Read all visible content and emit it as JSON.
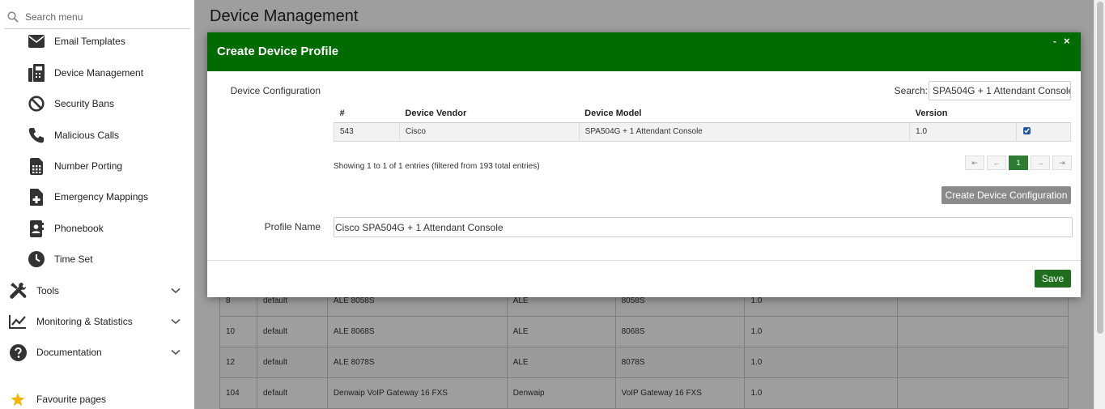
{
  "sidebar": {
    "search_placeholder": "Search menu",
    "items": [
      {
        "label": "Email Templates",
        "icon": "envelope-icon"
      },
      {
        "label": "Device Management",
        "icon": "fax-icon"
      },
      {
        "label": "Security Bans",
        "icon": "ban-icon"
      },
      {
        "label": "Malicious Calls",
        "icon": "phone-icon"
      },
      {
        "label": "Number Porting",
        "icon": "sim-card-icon"
      },
      {
        "label": "Emergency Mappings",
        "icon": "file-medical-icon"
      },
      {
        "label": "Phonebook",
        "icon": "address-book-icon"
      },
      {
        "label": "Time Set",
        "icon": "clock-icon"
      }
    ],
    "groups": [
      {
        "label": "Tools",
        "icon": "tools-icon"
      },
      {
        "label": "Monitoring & Statistics",
        "icon": "chart-line-icon"
      },
      {
        "label": "Documentation",
        "icon": "question-circle-icon"
      }
    ],
    "favourites": {
      "label": "Favourite pages",
      "icon": "star-icon"
    }
  },
  "page": {
    "title": "Device Management",
    "rows": [
      [
        "8",
        "default",
        "ALE 8058S",
        "ALE",
        "8058S",
        "1.0",
        ""
      ],
      [
        "10",
        "default",
        "ALE 8068S",
        "ALE",
        "8068S",
        "1.0",
        ""
      ],
      [
        "12",
        "default",
        "ALE 8078S",
        "ALE",
        "8078S",
        "1.0",
        ""
      ],
      [
        "104",
        "default",
        "Denwaip VoIP Gateway 16 FXS",
        "Denwaip",
        "VoIP Gateway 16 FXS",
        "1.0",
        ""
      ]
    ]
  },
  "modal": {
    "title": "Create Device Profile",
    "minimize": "-",
    "close": "×",
    "config_label": "Device Configuration",
    "search_label": "Search:",
    "search_value": "SPA504G + 1 Attendant Console",
    "columns": [
      "#",
      "Device Vendor",
      "Device Model",
      "Version"
    ],
    "row": {
      "id": "543",
      "vendor": "Cisco",
      "model": "SPA504G + 1 Attendant Console",
      "version": "1.0",
      "checked": true
    },
    "showing": "Showing 1 to 1 of 1 entries (filtered from 193 total entries)",
    "pager": {
      "first": "⇤",
      "prev": "←",
      "current": "1",
      "next": "→",
      "last": "⇥"
    },
    "create_config_label": "Create Device Configuration",
    "profile_name_label": "Profile Name",
    "profile_name_value": "Cisco SPA504G + 1 Attendant Console",
    "save_label": "Save"
  },
  "colors": {
    "header": "#006b00",
    "save": "#1e6e1e",
    "pager_active": "#2e7d32"
  }
}
